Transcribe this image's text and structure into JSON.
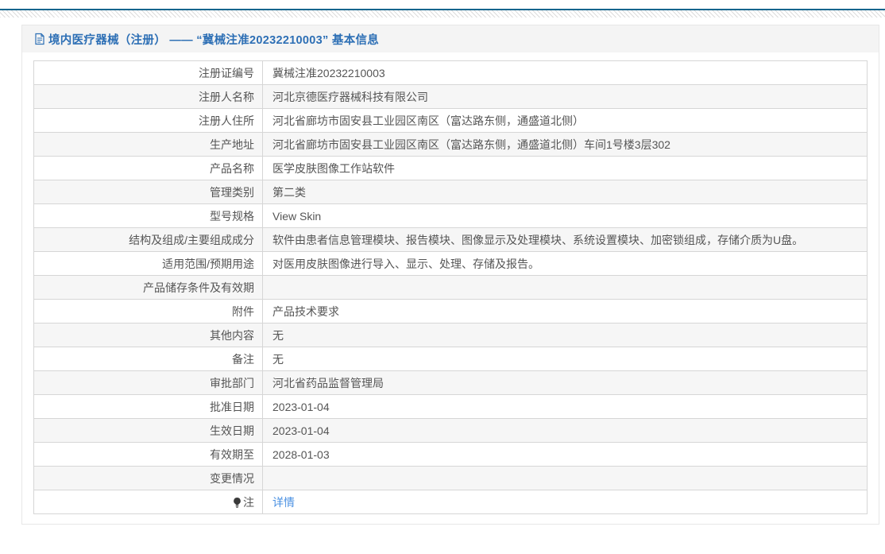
{
  "header": {
    "title": "境内医疗器械（注册） —— “冀械注准20232210003” 基本信息",
    "title_icon": "document-icon"
  },
  "colors": {
    "top_line": "#15658d",
    "title_text": "#2d6fb5",
    "link_text": "#4a90e2",
    "alt_row_bg": "#f6f6f6",
    "table_border": "#d6d6d6"
  },
  "table": {
    "rows": [
      {
        "label": "注册证编号",
        "value": "冀械注准20232210003"
      },
      {
        "label": "注册人名称",
        "value": "河北京德医疗器械科技有限公司"
      },
      {
        "label": "注册人住所",
        "value": "河北省廊坊市固安县工业园区南区（富达路东侧，通盛道北侧）"
      },
      {
        "label": "生产地址",
        "value": "河北省廊坊市固安县工业园区南区（富达路东侧，通盛道北侧）车间1号楼3层302"
      },
      {
        "label": "产品名称",
        "value": "医学皮肤图像工作站软件"
      },
      {
        "label": "管理类别",
        "value": "第二类"
      },
      {
        "label": "型号规格",
        "value": "View Skin"
      },
      {
        "label": "结构及组成/主要组成成分",
        "value": "软件由患者信息管理模块、报告模块、图像显示及处理模块、系统设置模块、加密锁组成，存储介质为U盘。"
      },
      {
        "label": "适用范围/预期用途",
        "value": "对医用皮肤图像进行导入、显示、处理、存储及报告。"
      },
      {
        "label": "产品储存条件及有效期",
        "value": ""
      },
      {
        "label": "附件",
        "value": "产品技术要求"
      },
      {
        "label": "其他内容",
        "value": "无"
      },
      {
        "label": "备注",
        "value": "无"
      },
      {
        "label": "审批部门",
        "value": "河北省药品监督管理局"
      },
      {
        "label": "批准日期",
        "value": "2023-01-04"
      },
      {
        "label": "生效日期",
        "value": "2023-01-04"
      },
      {
        "label": "有效期至",
        "value": "2028-01-03"
      },
      {
        "label": "变更情况",
        "value": ""
      },
      {
        "label": "注",
        "value": "详情",
        "label_icon": "bulb-icon",
        "value_is_link": true
      }
    ]
  }
}
